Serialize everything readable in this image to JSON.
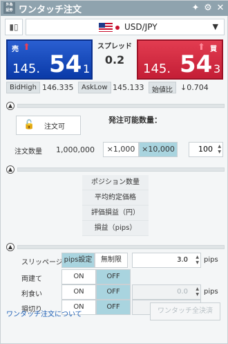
{
  "titlebar": {
    "logo_text": "外為\n証券",
    "title": "ワンタッチ注文"
  },
  "pair": {
    "icon": "candlestick-icon",
    "label": "USD/JPY"
  },
  "quotes": {
    "sell": {
      "label": "売",
      "small": "145.",
      "big": "54",
      "tiny": "1"
    },
    "buy": {
      "label": "買",
      "small": "145.",
      "big": "54",
      "tiny": "3"
    },
    "spread_label": "スプレッド",
    "spread_value": "0.2"
  },
  "stats": {
    "bid_high_label": "BidHigh",
    "bid_high": "146.335",
    "ask_low_label": "AskLow",
    "ask_low": "145.133",
    "change_label": "始値比",
    "change": "↓0.704"
  },
  "order": {
    "lock_text": "注文可",
    "avail_label": "発注可能数量：",
    "qty_label": "注文数量",
    "qty_value": "1,000,000",
    "mult_1000": "×1,000",
    "mult_10000": "×10,000",
    "qty_input": "100"
  },
  "position": {
    "rows": [
      "ポジション数量",
      "平均約定価格",
      "評価損益（円）",
      "損益（pips）"
    ]
  },
  "settings": {
    "slippage_label": "スリッページ",
    "pips_setting": "pips設定",
    "unlimited": "無制限",
    "slippage_value": "3.0",
    "unit": "pips",
    "both_label": "両建て",
    "take_label": "利食い",
    "stop_label": "損切り",
    "on": "ON",
    "off": "OFF",
    "zero": "0.0"
  },
  "footer": {
    "link": "ワンタッチ注文について",
    "close_all": "ワンタッチ全決済"
  }
}
